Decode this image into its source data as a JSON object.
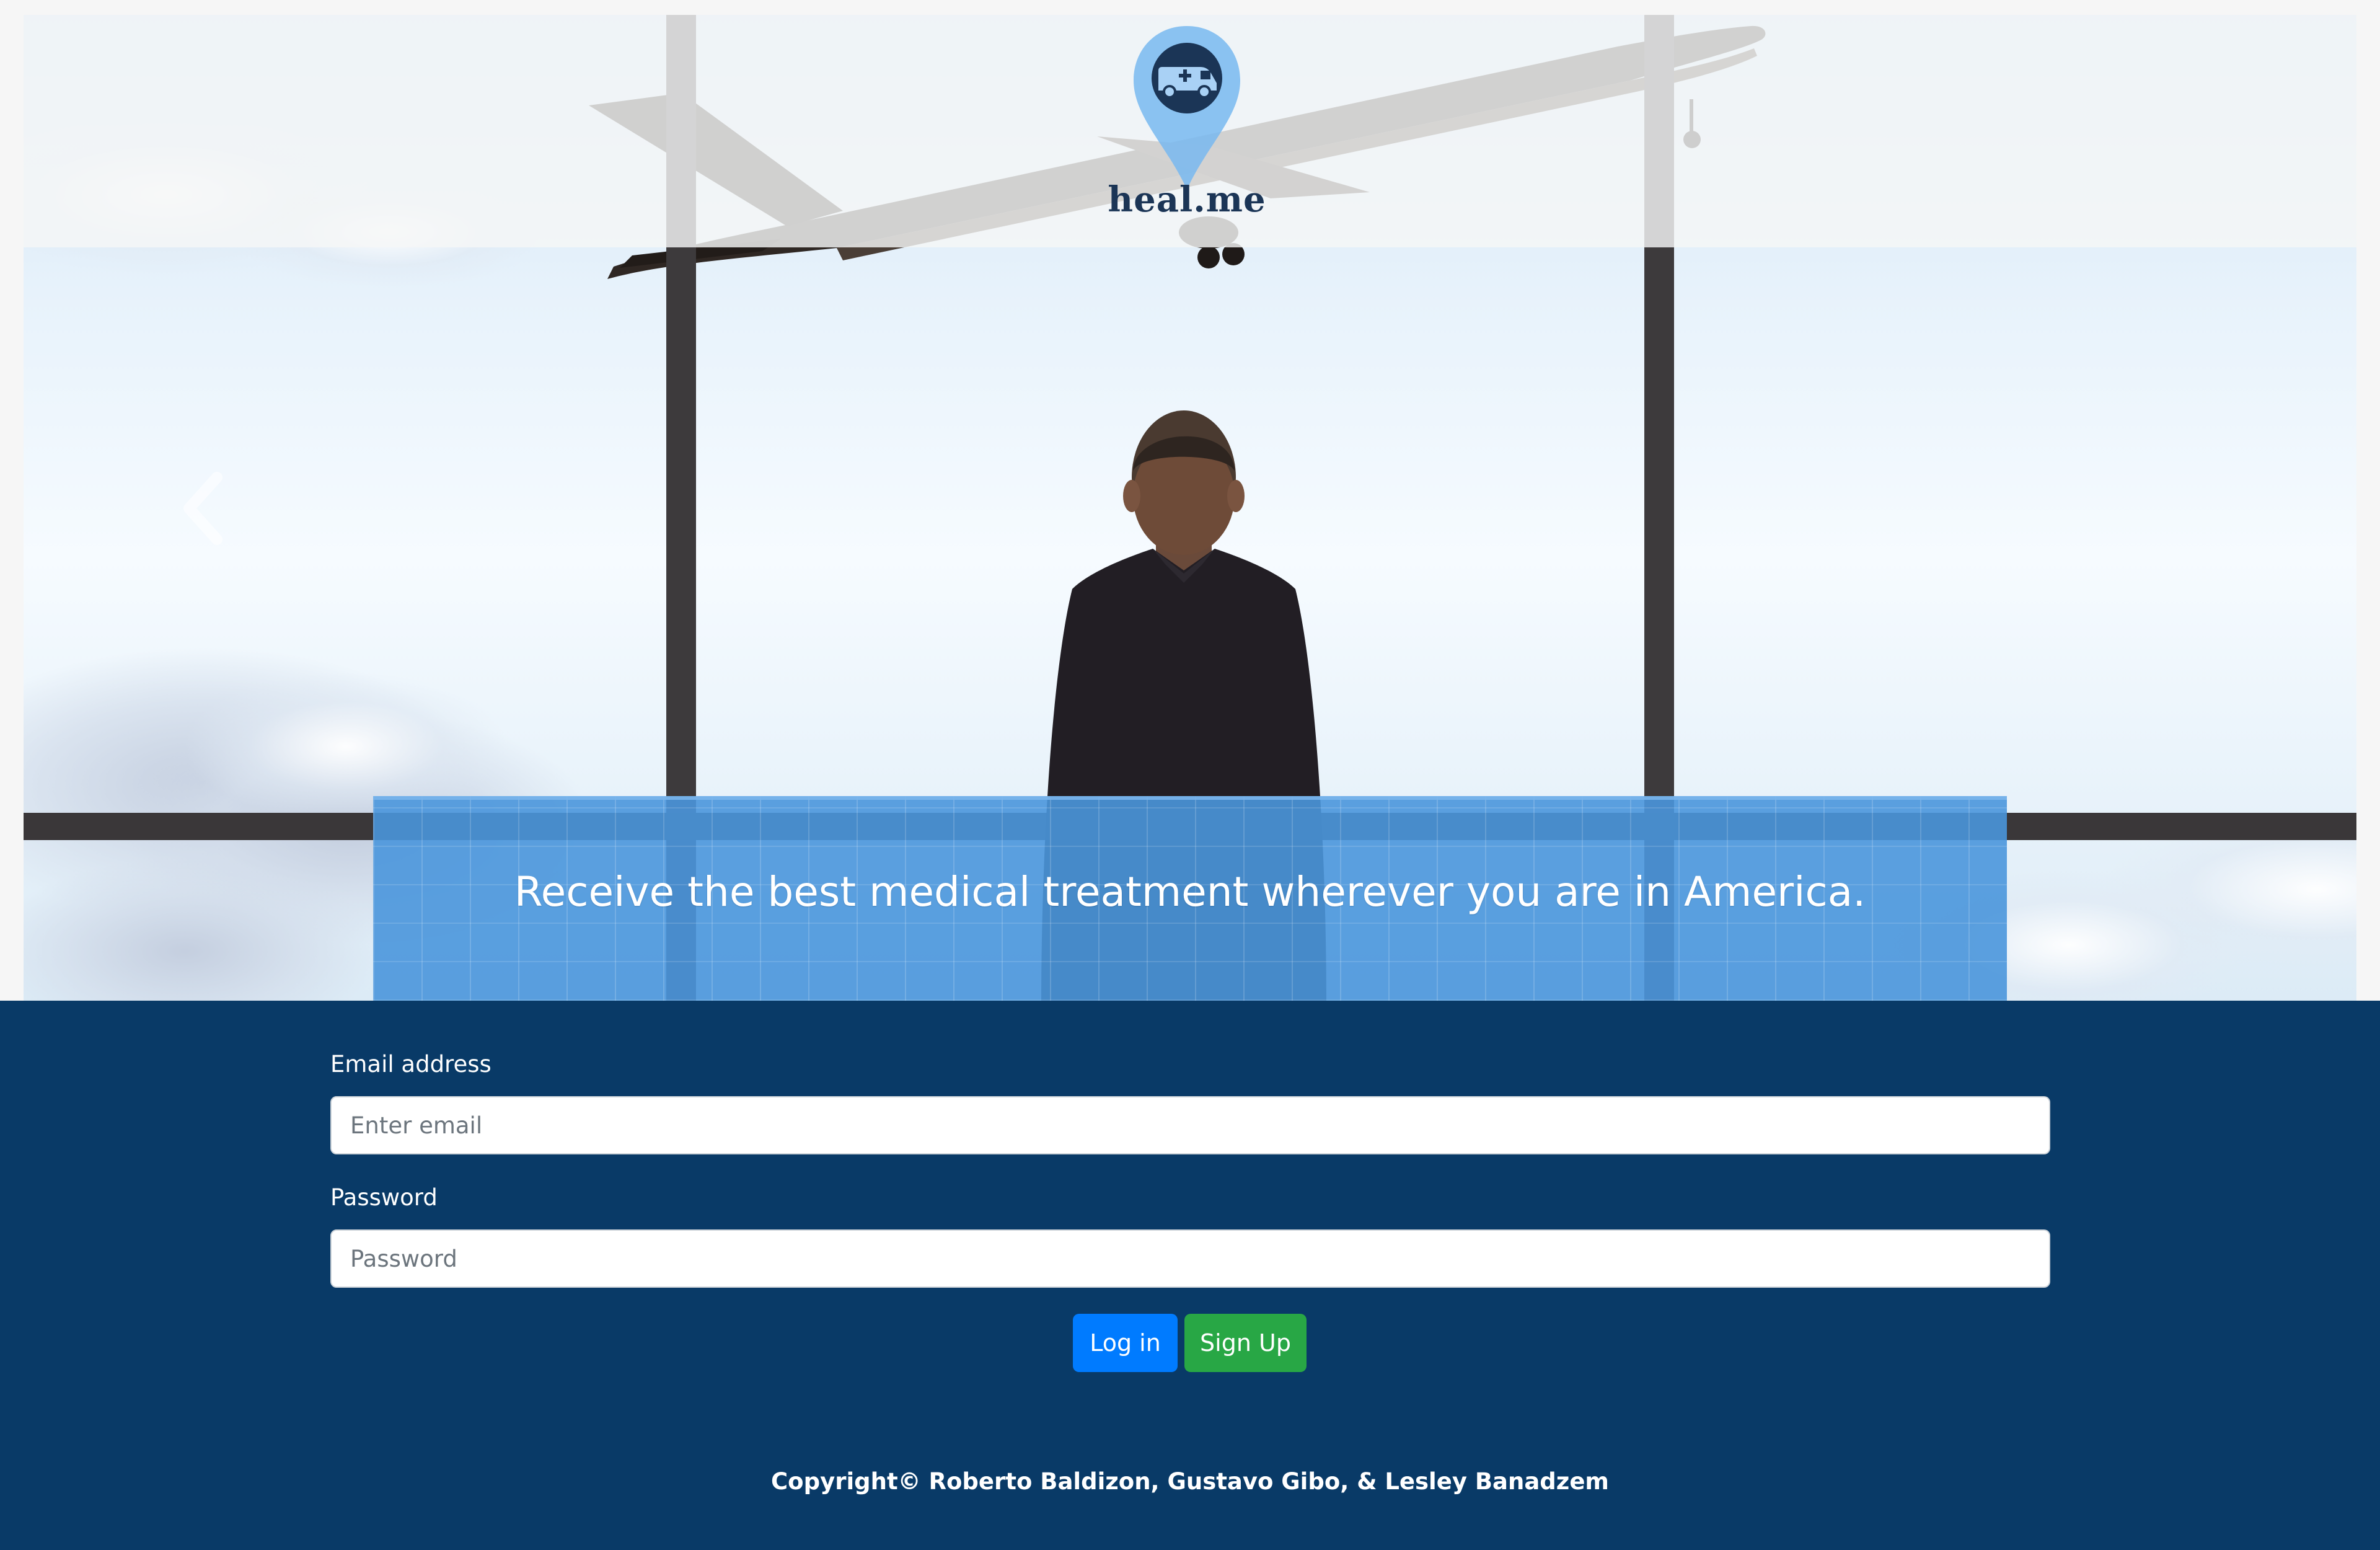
{
  "brand": {
    "name": "heal.me",
    "logo_icon": "ambulance-map-pin-icon",
    "pin_color": "#8ec5f4",
    "pin_inner_color": "#1b3556"
  },
  "carousel": {
    "prev_icon": "chevron-left-icon",
    "caption": "Receive the best medical treatment wherever you are in America."
  },
  "login_form": {
    "email_label": "Email address",
    "email_placeholder": "Enter email",
    "email_value": "",
    "password_label": "Password",
    "password_placeholder": "Password",
    "password_value": "",
    "login_label": "Log in",
    "signup_label": "Sign Up"
  },
  "footer": {
    "copyright": "Copyright© Roberto Baldizon, Gustavo Gibo, & Lesley Banadzem"
  },
  "colors": {
    "login_background": "#093a67",
    "login_button": "#007bff",
    "signup_button": "#28a745",
    "caption_panel": "#4a96dc"
  }
}
